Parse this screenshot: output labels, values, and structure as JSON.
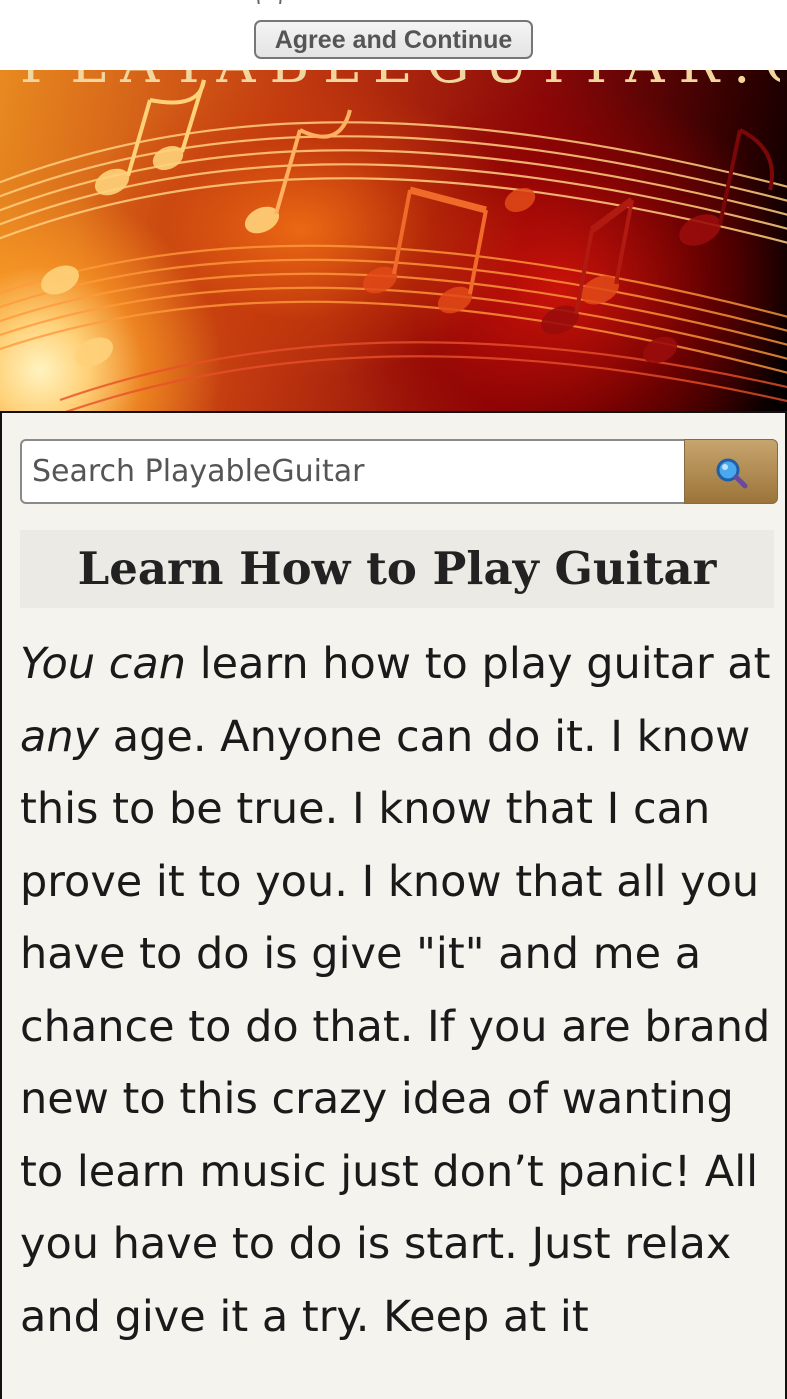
{
  "consent": {
    "cut_text": "(                    )",
    "agree_label": "Agree and Continue"
  },
  "banner": {
    "title_cut": "PLAYABLEGUITAR.COM",
    "image": "music-notes-staff-banner"
  },
  "search": {
    "placeholder": "Search PlayableGuitar",
    "value": "",
    "button_icon": "magnifier-icon"
  },
  "main": {
    "title": "Learn How to Play Guitar",
    "intro": {
      "em1": "You can",
      "text1": " learn how to play guitar at ",
      "em2": "any",
      "text2": " age. Anyone can do it. I know this to be true. I know that I can prove it to you. I know that all you have to do is give \"it\" and me a chance to do that. If you are brand new to this crazy idea of wanting to learn music just don’t panic! All you have to do is start. Just relax and give it a try. Keep at it"
    }
  },
  "colors": {
    "content_bg": "#f4f3ee",
    "search_button": "#b08a50",
    "heading_bg": "#ebeae4"
  }
}
